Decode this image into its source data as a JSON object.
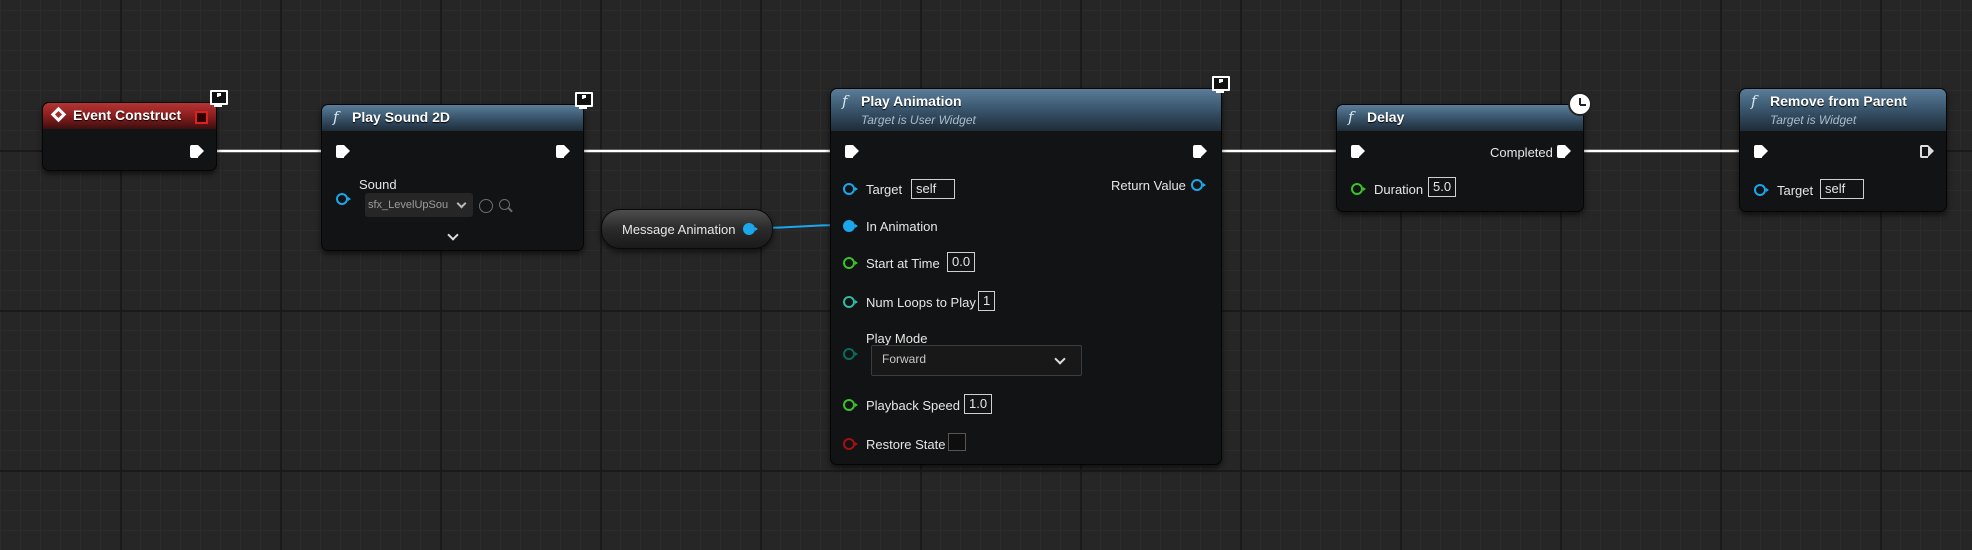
{
  "nodes": {
    "event_construct": {
      "title": "Event Construct"
    },
    "play_sound": {
      "title": "Play Sound 2D",
      "sound_label": "Sound",
      "sound_value": "sfx_LevelUpSou"
    },
    "message_animation": {
      "title": "Message Animation"
    },
    "play_animation": {
      "title": "Play Animation",
      "subtitle": "Target is User Widget",
      "target_label": "Target",
      "target_value": "self",
      "return_label": "Return Value",
      "in_animation_label": "In Animation",
      "start_time_label": "Start at Time",
      "start_time_value": "0.0",
      "num_loops_label": "Num Loops to Play",
      "num_loops_value": "1",
      "play_mode_label": "Play Mode",
      "play_mode_value": "Forward",
      "playback_speed_label": "Playback Speed",
      "playback_speed_value": "1.0",
      "restore_state_label": "Restore State"
    },
    "delay": {
      "title": "Delay",
      "completed_label": "Completed",
      "duration_label": "Duration",
      "duration_value": "5.0"
    },
    "remove_from_parent": {
      "title": "Remove from Parent",
      "subtitle": "Target is Widget",
      "target_label": "Target",
      "target_value": "self"
    }
  },
  "icons": {
    "function": "f-function-icon",
    "event": "event-diamond-icon",
    "network": "monitor-icon",
    "latent": "clock-icon",
    "exec": "exec-pin-arrow"
  },
  "colors": {
    "event_header": "#b53535",
    "function_header": "#4a6b85",
    "object_pin": "#1aa7ec",
    "float_pin": "#3bc12a",
    "int_pin": "#2fb9a1",
    "byte_pin": "#0c6a5c",
    "bool_pin": "#a51010"
  }
}
